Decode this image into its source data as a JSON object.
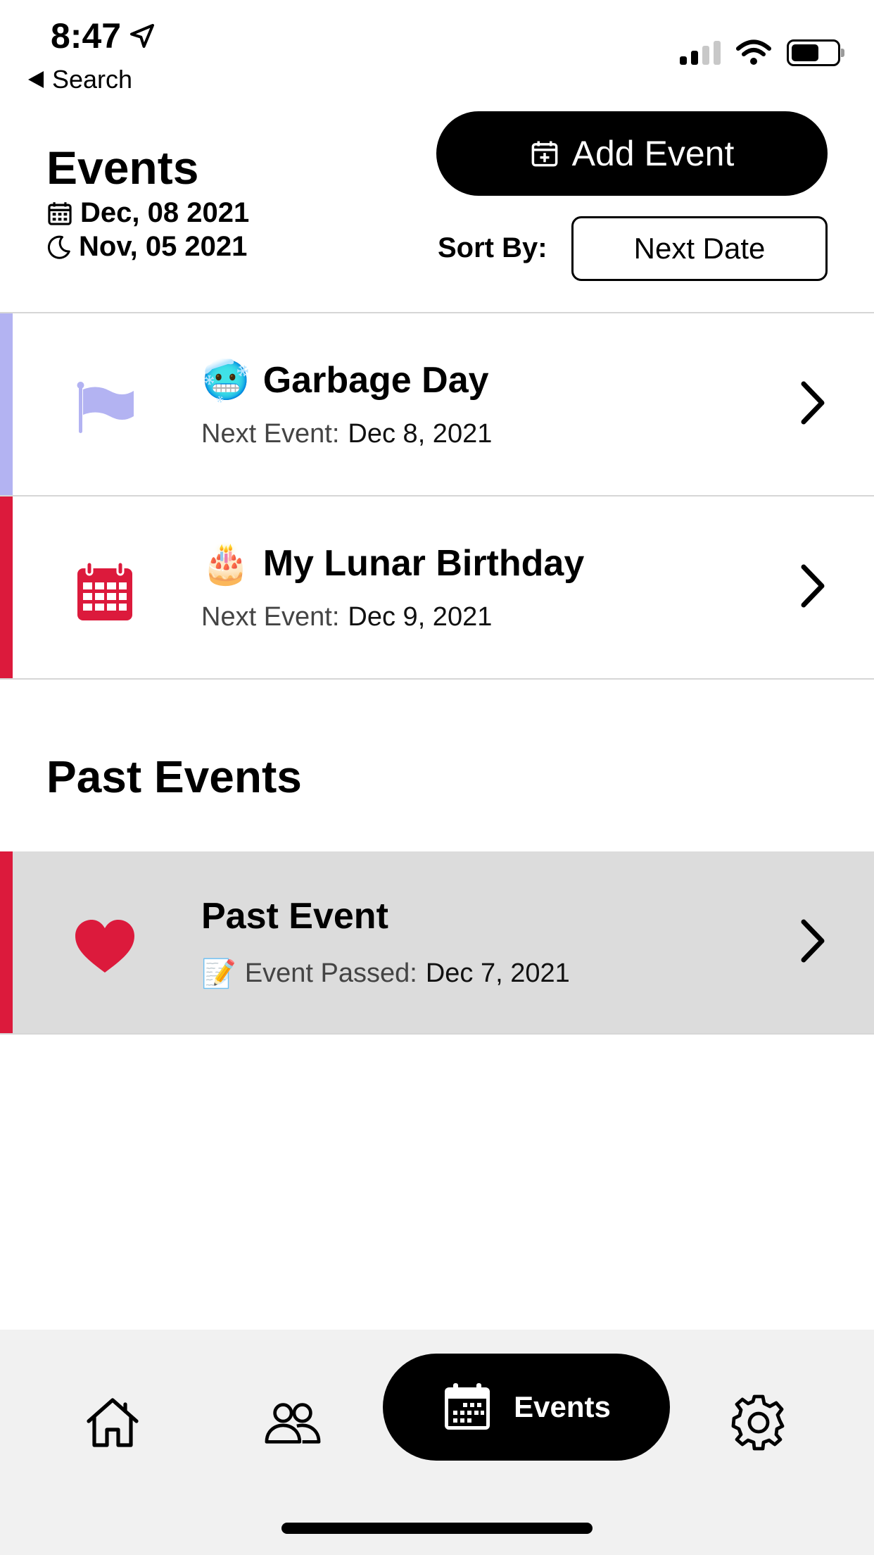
{
  "status": {
    "time": "8:47",
    "back_label": "Search"
  },
  "header": {
    "title": "Events",
    "solar_date": "Dec, 08 2021",
    "lunar_date": "Nov, 05 2021",
    "add_event_label": "Add Event",
    "sort_label": "Sort By:",
    "sort_value": "Next Date"
  },
  "events": [
    {
      "emoji": "🥶",
      "title": "Garbage Day",
      "sub_label": "Next Event:",
      "sub_value": "Dec 8, 2021",
      "icon": "flag-icon",
      "accent": "#b3b3f2"
    },
    {
      "emoji": "🎂",
      "title": "My Lunar Birthday",
      "sub_label": "Next Event:",
      "sub_value": "Dec 9, 2021",
      "icon": "calendar-grid-icon",
      "accent": "#dc1a3c"
    }
  ],
  "past_section": {
    "title": "Past Events",
    "items": [
      {
        "title": "Past Event",
        "sub_emoji": "📝",
        "sub_label": "Event Passed:",
        "sub_value": "Dec 7, 2021",
        "icon": "heart-icon",
        "accent": "#dc1a3c"
      }
    ]
  },
  "tabbar": {
    "tabs": [
      {
        "icon": "home-icon"
      },
      {
        "icon": "people-icon"
      },
      {
        "icon": "calendar-icon",
        "label": "Events",
        "active": true
      },
      {
        "icon": "gear-icon"
      }
    ]
  }
}
